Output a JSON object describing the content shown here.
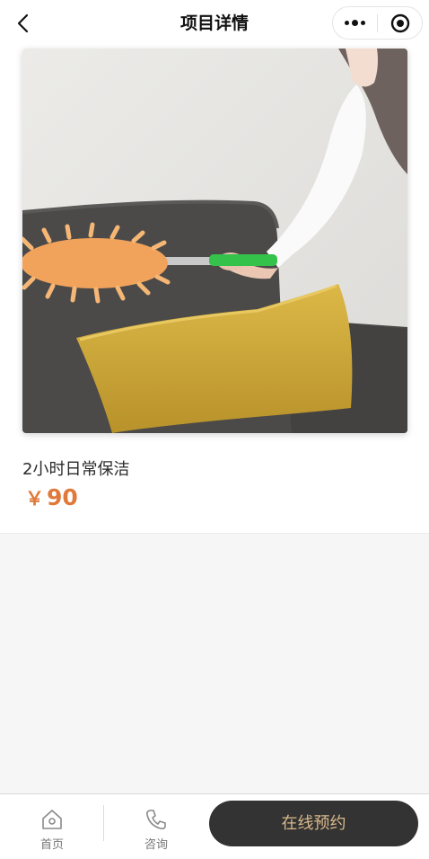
{
  "navbar": {
    "title": "项目详情",
    "back_icon": "chevron-left-icon",
    "more_icon": "more-dots-icon",
    "close_icon": "target-circle-icon"
  },
  "product": {
    "image_alt": "dusting a sofa with an orange microfiber duster",
    "name": "2小时日常保洁",
    "currency": "￥",
    "price": "90"
  },
  "bottom_bar": {
    "home": {
      "label": "首页",
      "icon": "home-icon"
    },
    "consult": {
      "label": "咨询",
      "icon": "phone-icon"
    },
    "book_label": "在线预约"
  },
  "colors": {
    "price": "#e07a3b",
    "book_button_bg": "#333333",
    "book_button_text": "#d9b98a",
    "page_bg": "#f6f6f6"
  }
}
